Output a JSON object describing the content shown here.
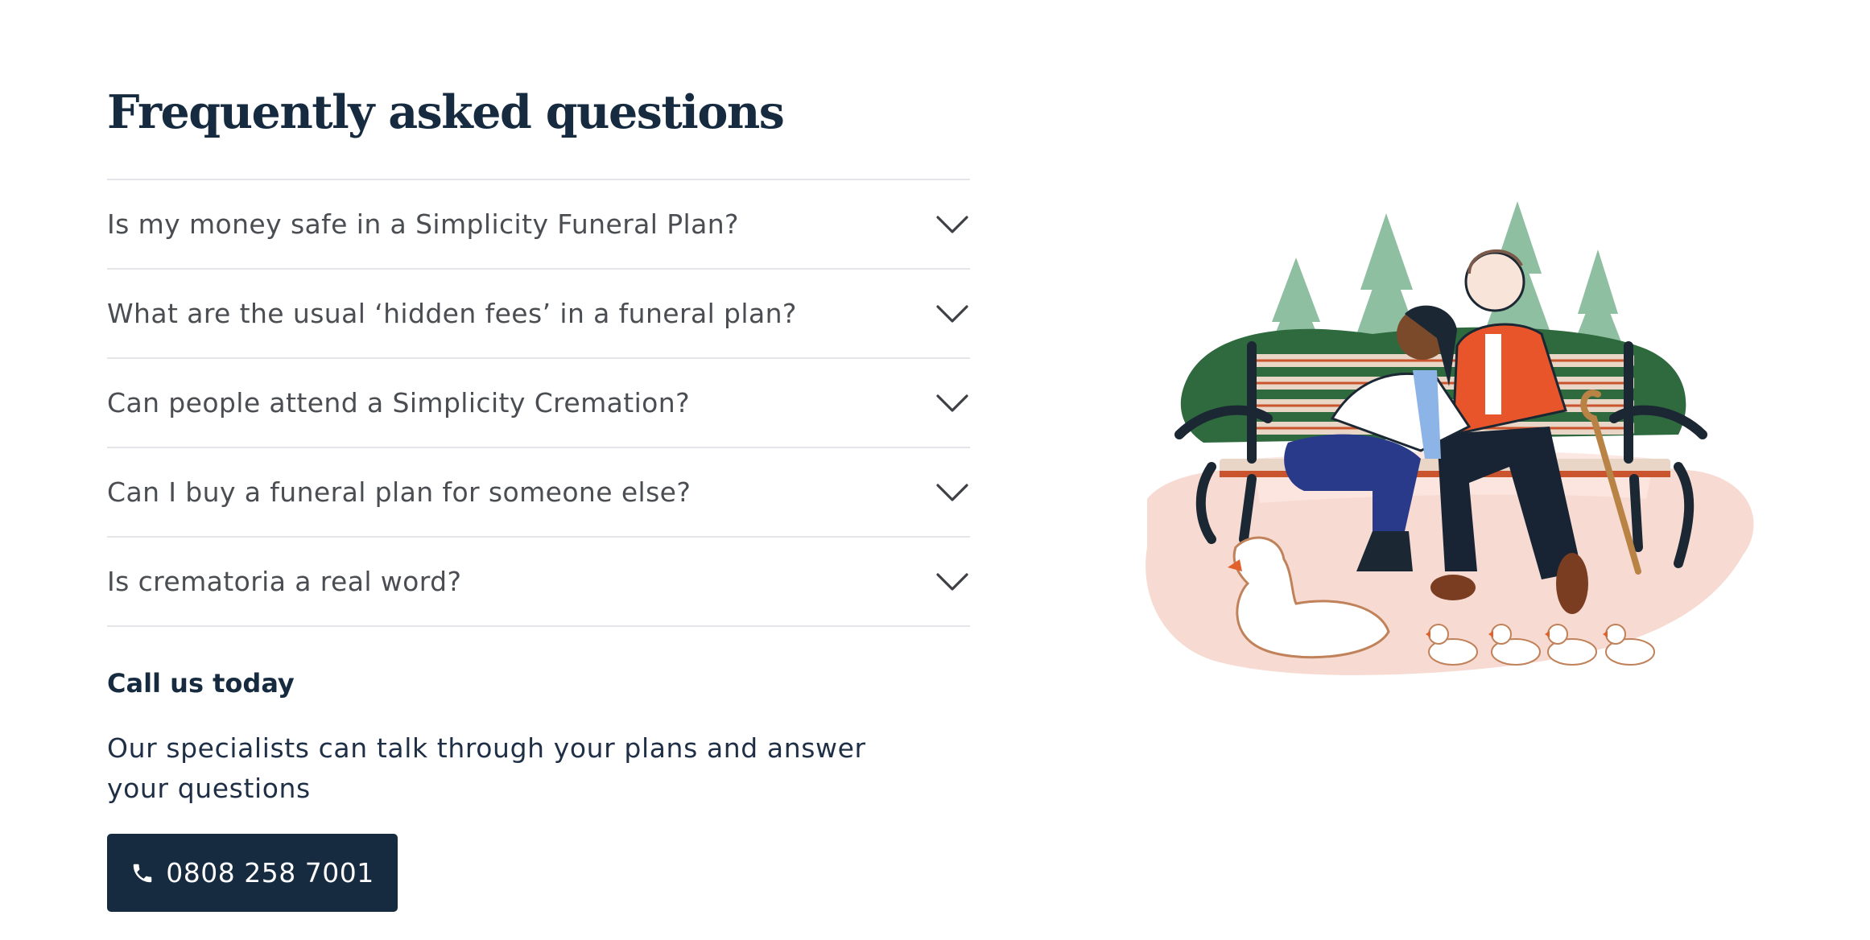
{
  "faq": {
    "title": "Frequently asked questions",
    "items": [
      {
        "question": "Is my money safe in a Simplicity Funeral Plan?"
      },
      {
        "question": "What are the usual ‘hidden fees’ in a funeral plan?"
      },
      {
        "question": "Can people attend a Simplicity Cremation?"
      },
      {
        "question": "Can I buy a funeral plan for someone else?"
      },
      {
        "question": "Is crematoria a real word?"
      }
    ]
  },
  "contact": {
    "heading": "Call us today",
    "text": "Our specialists can talk through your plans and answer your questions",
    "phone_label": "0808 258 7001",
    "phone_icon": "phone-icon"
  },
  "illustration": {
    "description_icon": "couple-on-bench-with-ducks-illustration"
  },
  "colors": {
    "navy": "#172b40",
    "divider": "#e3e5e8",
    "question_text": "#4a4d52"
  }
}
